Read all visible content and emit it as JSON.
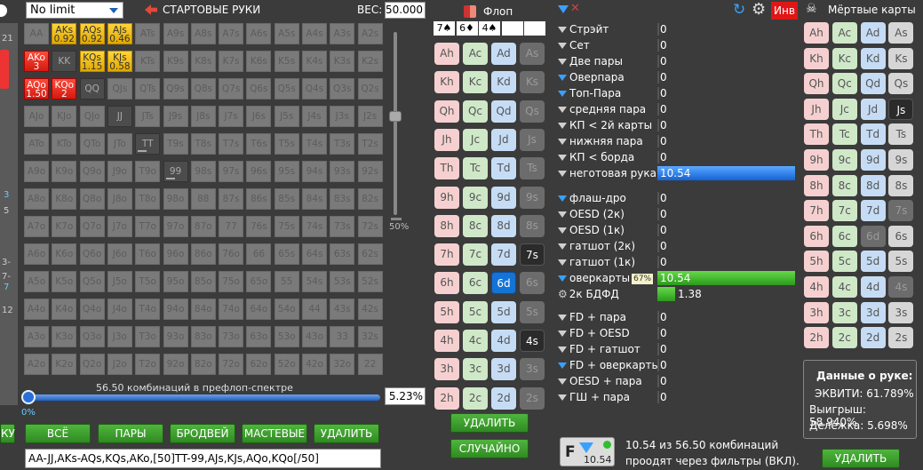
{
  "top": {
    "limit_select": "No limit",
    "start_hands_label": "СТАРТОВЫЕ РУКИ",
    "weight_label": "ВЕС:",
    "weight_value": "50.000",
    "flop_label": "Флоп",
    "inv_label": "Инв",
    "dead_cards_label": "Мёртвые карты"
  },
  "left_edge": [
    "21",
    "3",
    "5",
    "7-",
    "7",
    "12",
    "3-"
  ],
  "grid": [
    [
      "AA",
      "AKs",
      "AQs",
      "AJs",
      "ATs",
      "A9s",
      "A8s",
      "A7s",
      "A6s",
      "A5s",
      "A4s",
      "A3s",
      "A2s"
    ],
    [
      "AKo",
      "KK",
      "KQs",
      "KJs",
      "KTs",
      "K9s",
      "K8s",
      "K7s",
      "K6s",
      "K5s",
      "K4s",
      "K3s",
      "K2s"
    ],
    [
      "AQo",
      "KQo",
      "QQ",
      "QJs",
      "QTs",
      "Q9s",
      "Q8s",
      "Q7s",
      "Q6s",
      "Q5s",
      "Q4s",
      "Q3s",
      "Q2s"
    ],
    [
      "AJo",
      "KJo",
      "QJo",
      "JJ",
      "JTs",
      "J9s",
      "J8s",
      "J7s",
      "J6s",
      "J5s",
      "J4s",
      "J3s",
      "J2s"
    ],
    [
      "ATo",
      "KTo",
      "QTo",
      "JTo",
      "TT",
      "T9s",
      "T8s",
      "T7s",
      "T6s",
      "T5s",
      "T4s",
      "T3s",
      "T2s"
    ],
    [
      "A9o",
      "K9o",
      "Q9o",
      "J9o",
      "T9o",
      "99",
      "98s",
      "97s",
      "96s",
      "95s",
      "94s",
      "93s",
      "92s"
    ],
    [
      "A8o",
      "K8o",
      "Q8o",
      "J8o",
      "T8o",
      "98o",
      "88",
      "87s",
      "86s",
      "85s",
      "84s",
      "83s",
      "82s"
    ],
    [
      "A7o",
      "K7o",
      "Q7o",
      "J7o",
      "T7o",
      "97o",
      "87o",
      "77",
      "76s",
      "75s",
      "74s",
      "73s",
      "72s"
    ],
    [
      "A6o",
      "K6o",
      "Q6o",
      "J6o",
      "T6o",
      "96o",
      "86o",
      "76o",
      "66",
      "65s",
      "64s",
      "63s",
      "62s"
    ],
    [
      "A5o",
      "K5o",
      "Q5o",
      "J5o",
      "T5o",
      "95o",
      "85o",
      "75o",
      "65o",
      "55",
      "54s",
      "53s",
      "52s"
    ],
    [
      "A4o",
      "K4o",
      "Q4o",
      "J4o",
      "T4o",
      "94o",
      "84o",
      "74o",
      "64o",
      "54o",
      "44",
      "43s",
      "42s"
    ],
    [
      "A3o",
      "K3o",
      "Q3o",
      "J3o",
      "T3o",
      "93o",
      "83o",
      "73o",
      "63o",
      "53o",
      "43o",
      "33",
      "32s"
    ],
    [
      "A2o",
      "K2o",
      "Q2o",
      "J2o",
      "T2o",
      "92o",
      "82o",
      "72o",
      "62o",
      "52o",
      "42o",
      "32o",
      "22"
    ]
  ],
  "grid_selected": {
    "AKs": "0.92",
    "AQs": "0.92",
    "AJs": "0.46",
    "KQs": "1.15",
    "KJs": "0.58",
    "AKo": "3",
    "AQo": "1.50",
    "KQo": "2"
  },
  "slider_right": "50%",
  "combos_label": "56.50 комбинаций в префлоп-спектре",
  "percent_box": "5.23%",
  "slider_zero": "0%",
  "left_btn": "КУ",
  "bottom_buttons": [
    "ВСЁ",
    "ПАРЫ",
    "БРОДВЕЙ",
    "МАСТЕВЫЕ",
    "УДАЛИТЬ"
  ],
  "range_text": "AA-JJ,AKs-AQs,KQs,AKo,[50]TT-99,AJs,KJs,AQo,KQo[/50]",
  "flop_slots": [
    "7♠",
    "6♦",
    "4♠",
    "",
    ""
  ],
  "flop_cards": [
    [
      "Ah",
      "Ac",
      "Ad",
      "As"
    ],
    [
      "Kh",
      "Kc",
      "Kd",
      "Ks"
    ],
    [
      "Qh",
      "Qc",
      "Qd",
      "Qs"
    ],
    [
      "Jh",
      "Jc",
      "Jd",
      "Js"
    ],
    [
      "Th",
      "Tc",
      "Td",
      "Ts"
    ],
    [
      "9h",
      "9c",
      "9d",
      "9s"
    ],
    [
      "8h",
      "8c",
      "8d",
      "8s"
    ],
    [
      "7h",
      "7c",
      "7d",
      "7s"
    ],
    [
      "6h",
      "6c",
      "6d",
      "6s"
    ],
    [
      "5h",
      "5c",
      "5d",
      "5s"
    ],
    [
      "4h",
      "4c",
      "4d",
      "4s"
    ],
    [
      "3h",
      "3c",
      "3d",
      "3s"
    ],
    [
      "2h",
      "2c",
      "2d",
      "2s"
    ]
  ],
  "flop_buttons": [
    "УДАЛИТЬ",
    "СЛУЧАЙНО"
  ],
  "filters": [
    {
      "label": "Стрэйт",
      "value": "0",
      "icon": "grey"
    },
    {
      "label": "Сет",
      "value": "0",
      "icon": "grey"
    },
    {
      "label": "Две пары",
      "value": "0",
      "icon": "grey"
    },
    {
      "label": "Оверпара",
      "value": "0",
      "icon": "blue"
    },
    {
      "label": "Топ-Пара",
      "value": "0",
      "icon": "blue"
    },
    {
      "label": "средняя пара",
      "value": "0",
      "icon": "grey"
    },
    {
      "label": "КП < 2й карты",
      "value": "0",
      "icon": "grey"
    },
    {
      "label": "нижняя пара",
      "value": "0",
      "icon": "grey"
    },
    {
      "label": "КП < борда",
      "value": "0",
      "icon": "grey"
    },
    {
      "label": "неготовая рука",
      "value": "10.54",
      "icon": "grey",
      "bar": "blue"
    },
    {
      "label": "флаш-дро",
      "value": "0",
      "icon": "blue"
    },
    {
      "label": "OESD (2к)",
      "value": "0",
      "icon": "grey"
    },
    {
      "label": "OESD (1к)",
      "value": "0",
      "icon": "grey"
    },
    {
      "label": "гатшот (2к)",
      "value": "0",
      "icon": "grey"
    },
    {
      "label": "гатшот (1к)",
      "value": "0",
      "icon": "grey"
    },
    {
      "label": "оверкарты",
      "value": "10.54",
      "icon": "blue",
      "bar": "green",
      "badge": "67%"
    },
    {
      "label": "2к БДФД",
      "value": "1.38",
      "icon": "gear",
      "bar": "green-small"
    },
    {
      "label": "FD + пара",
      "value": "0",
      "icon": "grey"
    },
    {
      "label": "FD + OESD",
      "value": "0",
      "icon": "grey"
    },
    {
      "label": "FD + гатшот",
      "value": "0",
      "icon": "grey"
    },
    {
      "label": "FD + оверкарты",
      "value": "0",
      "icon": "blue"
    },
    {
      "label": "OESD + пара",
      "value": "0",
      "icon": "grey"
    },
    {
      "label": "ГШ + пара",
      "value": "0",
      "icon": "grey"
    }
  ],
  "summary_icon_value": "10.54",
  "summary_text_1": "10.54 из 56.50 комбинаций",
  "summary_text_2": "проодят через фильтры (ВКЛ).",
  "dead_cards": [
    [
      "Ah",
      "Ac",
      "Ad",
      "As"
    ],
    [
      "Kh",
      "Kc",
      "Kd",
      "Ks"
    ],
    [
      "Qh",
      "Qc",
      "Qd",
      "Qs"
    ],
    [
      "Jh",
      "Jc",
      "Jd",
      "Js"
    ],
    [
      "Th",
      "Tc",
      "Td",
      "Ts"
    ],
    [
      "9h",
      "9c",
      "9d",
      "9s"
    ],
    [
      "8h",
      "8c",
      "8d",
      "8s"
    ],
    [
      "7h",
      "7c",
      "7d",
      "7s"
    ],
    [
      "6h",
      "6c",
      "6d",
      "6s"
    ],
    [
      "5h",
      "5c",
      "5d",
      "5s"
    ],
    [
      "4h",
      "4c",
      "4d",
      "4s"
    ],
    [
      "3h",
      "3c",
      "3d",
      "3s"
    ],
    [
      "2h",
      "2c",
      "2d",
      "2s"
    ]
  ],
  "hand_data": {
    "title": "Данные о руке:",
    "equity": "ЭКВИТИ: 61.789%",
    "win": "Выигрыш: 58.940%",
    "split": "Делёжка: 5.698%"
  },
  "dead_delete": "УДАЛИТЬ"
}
